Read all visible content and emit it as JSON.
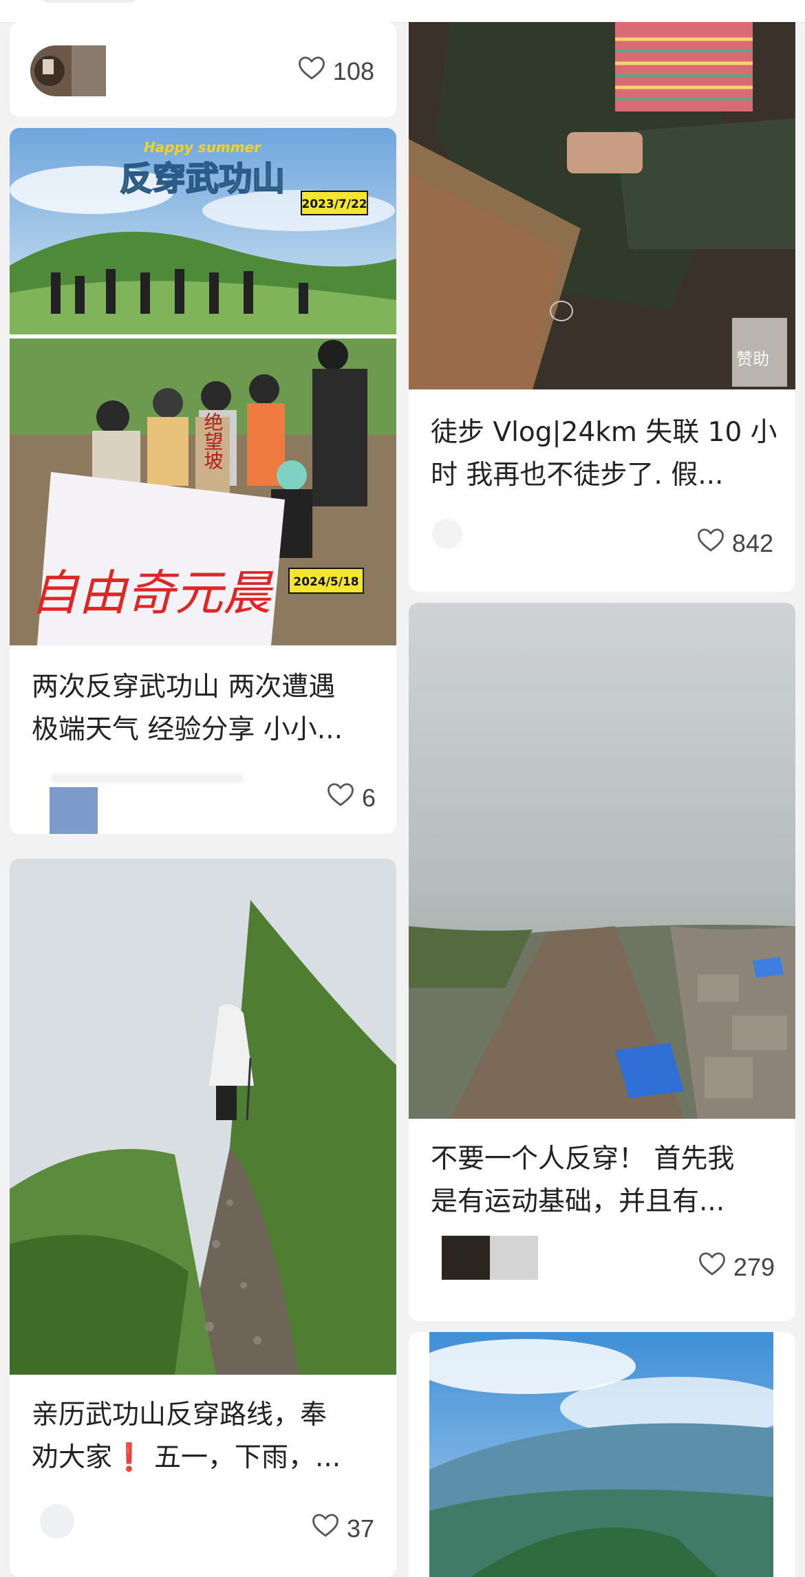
{
  "cards": [
    {
      "likes": "108"
    },
    {
      "title_line1": "两次反穿武功山 两次遭遇",
      "title_line2": "极端天气 经验分享 小小...",
      "likes": "6",
      "image_text": {
        "banner": "反穿武功山",
        "tagline": "Happy summer",
        "date1": "2023/7/22",
        "date2": "2024/5/18",
        "flag": "自由奇元晨",
        "sign": "绝望坡"
      }
    },
    {
      "title_line1": "亲历武功山反穿路线，奉",
      "title_line2_a": "劝大家",
      "title_line2_mark": "❗",
      "title_line2_b": " 五一，下雨，...",
      "likes": "37"
    },
    {
      "sponsor_label": "赞助",
      "title_line1": "徒步 Vlog|24km 失联 10 小",
      "title_line2": "时 我再也不徒步了. 假...",
      "likes": "842"
    },
    {
      "title_line1": "不要一个人反穿！ 首先我",
      "title_line2": "是有运动基础，并且有...",
      "likes": "279"
    },
    {}
  ],
  "colors": {
    "like_icon": "#555555",
    "text": "#222222",
    "exclaim": "#e02020"
  },
  "icons": {
    "like": "heart-outline-icon"
  }
}
